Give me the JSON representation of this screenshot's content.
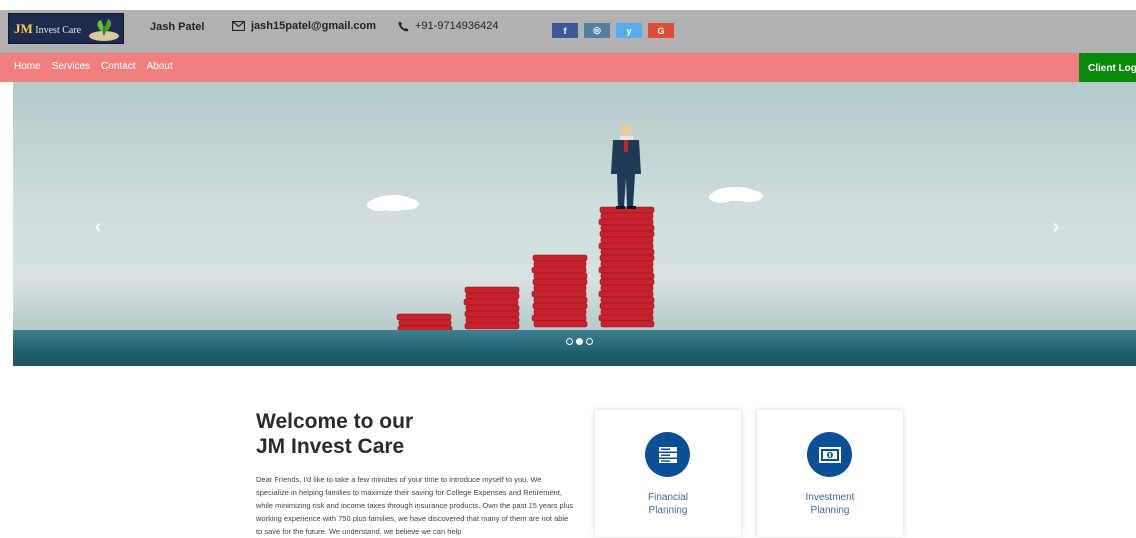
{
  "header": {
    "logo_initials": "JM",
    "logo_name": "Invest Care",
    "owner_name": "Jash Patel",
    "email": "jash15patel@gmail.com",
    "phone": "+91-9714936424",
    "socials": [
      {
        "icon": "facebook-icon",
        "glyph": "f"
      },
      {
        "icon": "instagram-icon",
        "glyph": "◎"
      },
      {
        "icon": "twitter-icon",
        "glyph": "y"
      },
      {
        "icon": "google-icon",
        "glyph": "G"
      }
    ]
  },
  "nav": {
    "items": [
      "Home",
      "Services",
      "Contact",
      "About"
    ],
    "client_login": "Client Login"
  },
  "hero": {
    "prev_glyph": "‹",
    "next_glyph": "›",
    "slides": 3,
    "active_slide": 2
  },
  "welcome": {
    "title_line1": "Welcome to our",
    "title_line2": "JM Invest Care",
    "body": "Dear Friends, I'd like to take a few minutes of your time to introduce myself to you. We specialize in helping families to maximize their saving for College Expenses and Retirement, while minimizing risk and income taxes through insurance products. Own the past 15 years plus working experience with 750 plus families, we have discovered that many of them are not able to save for the future. We understand, we believe we can help"
  },
  "cards": [
    {
      "icon": "server-icon",
      "line1": "Financial",
      "line2": "Planning"
    },
    {
      "icon": "money-icon",
      "line1": "Investment",
      "line2": "Planning"
    }
  ],
  "colors": {
    "topbar": "#b2b2b2",
    "nav": "#f08080",
    "client_login": "#0a8a0a",
    "card_icon": "#0b4f96"
  }
}
